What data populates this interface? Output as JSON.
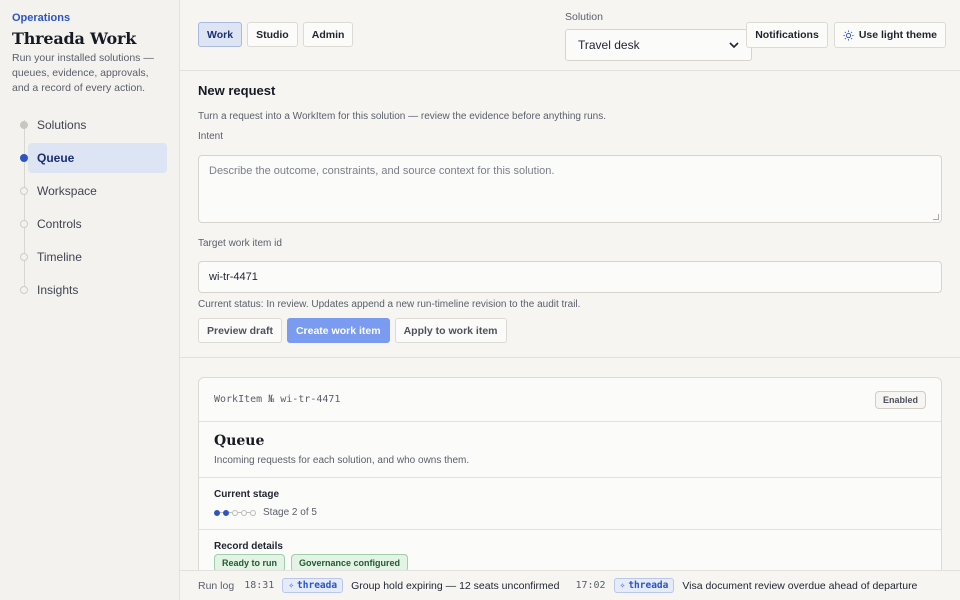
{
  "sidebar": {
    "eyebrow": "Operations",
    "title": "Threada Work",
    "description": "Run your installed solutions — queues, evidence, approvals, and a record of every action.",
    "items": [
      {
        "label": "Solutions"
      },
      {
        "label": "Queue",
        "active": true
      },
      {
        "label": "Workspace"
      },
      {
        "label": "Controls"
      },
      {
        "label": "Timeline"
      },
      {
        "label": "Insights"
      }
    ]
  },
  "topbar": {
    "tabs": [
      {
        "label": "Work",
        "active": true
      },
      {
        "label": "Studio"
      },
      {
        "label": "Admin"
      }
    ],
    "solution_label": "Solution",
    "solution_value": "Travel desk",
    "notifications_label": "Notifications",
    "theme_label": "Use light theme"
  },
  "request": {
    "title": "New request",
    "subtitle": "Turn a request into a WorkItem for this solution — review the evidence before anything runs.",
    "intent_label": "Intent",
    "intent_placeholder": "Describe the outcome, constraints, and source context for this solution.",
    "target_label": "Target work item id",
    "target_value": "wi-tr-4471",
    "status_text": "Current status: In review. Updates append a new run-timeline revision to the audit trail.",
    "actions": {
      "preview": "Preview draft",
      "create": "Create work item",
      "apply": "Apply to work item"
    }
  },
  "card": {
    "id_line": "WorkItem № wi-tr-4471",
    "badge": "Enabled",
    "title": "Queue",
    "description": "Incoming requests for each solution, and who owns them.",
    "stage_label": "Current stage",
    "stage_current": 2,
    "stage_total": 5,
    "stage_text": "Stage 2 of 5",
    "record_label": "Record details",
    "tags": [
      "Ready to run",
      "Governance configured"
    ]
  },
  "runlog": {
    "label": "Run log",
    "entries": [
      {
        "time": "18:31",
        "source": "threada",
        "message": "Group hold expiring — 12 seats unconfirmed"
      },
      {
        "time": "17:02",
        "source": "threada",
        "message": "Visa document review overdue ahead of departure"
      }
    ]
  },
  "colors": {
    "accent": "#2c54c7",
    "primary_button": "#7b9bf0",
    "tag_green": "#e3f3e5"
  }
}
